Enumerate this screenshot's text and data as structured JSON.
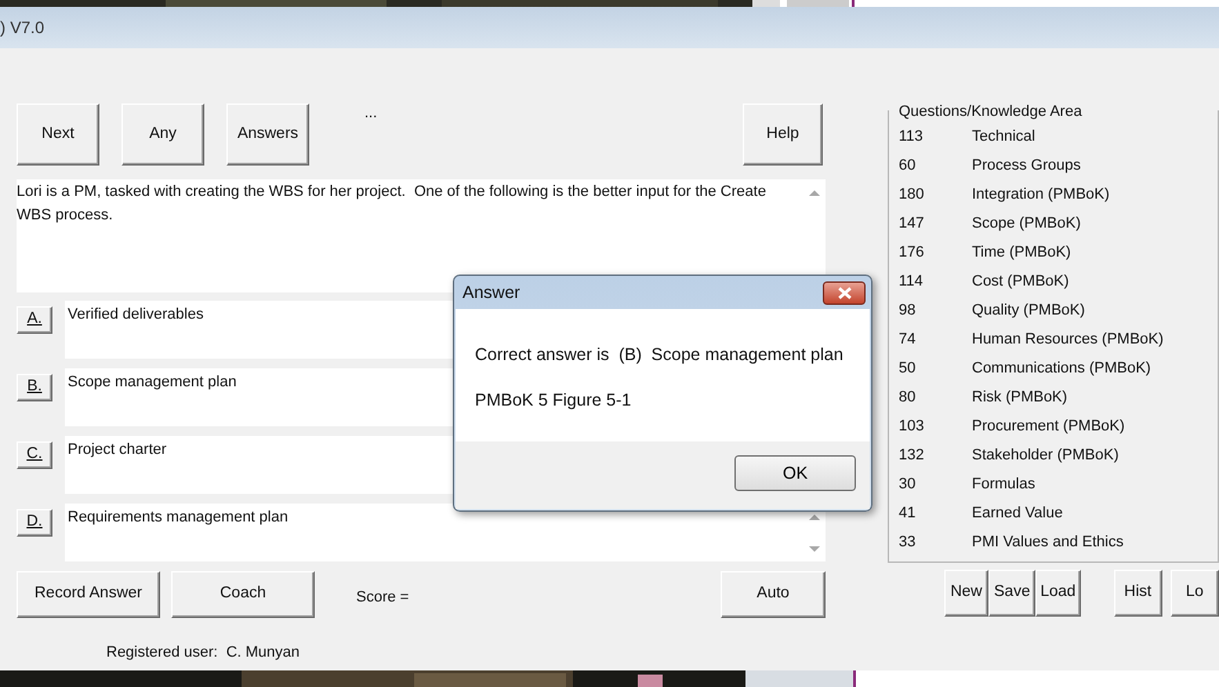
{
  "window": {
    "title": ") V7.0"
  },
  "toolbar": {
    "buttons": [
      "Next",
      "Any",
      "Answers"
    ],
    "ellipsis": "...",
    "help": "Help"
  },
  "question": {
    "text": "Lori is a PM, tasked with creating the WBS for her project.  One of the following is the better input for the Create WBS process.",
    "scrollbar": true
  },
  "options": [
    {
      "letter": "A.",
      "text": "Verified deliverables"
    },
    {
      "letter": "B.",
      "text": "Scope management plan"
    },
    {
      "letter": "C.",
      "text": "Project charter"
    },
    {
      "letter": "D.",
      "text": "Requirements management plan",
      "scrollbar": true
    }
  ],
  "bottom": {
    "buttons": [
      "Record Answer",
      "Coach"
    ],
    "score_label": "Score =",
    "auto": "Auto"
  },
  "file_buttons": [
    "New",
    "Save",
    "Load"
  ],
  "extra_buttons": [
    "Hist",
    "Lo"
  ],
  "registered": "Registered user:  C. Munyan",
  "knowledge_areas": {
    "title": "Questions/Knowledge Area",
    "rows": [
      {
        "count": "113",
        "area": "Technical"
      },
      {
        "count": "60",
        "area": "Process Groups"
      },
      {
        "count": "180",
        "area": "Integration (PMBoK)"
      },
      {
        "count": "147",
        "area": "Scope (PMBoK)"
      },
      {
        "count": "176",
        "area": "Time (PMBoK)"
      },
      {
        "count": "114",
        "area": "Cost (PMBoK)"
      },
      {
        "count": "98",
        "area": "Quality (PMBoK)"
      },
      {
        "count": "74",
        "area": "Human Resources (PMBoK)"
      },
      {
        "count": "50",
        "area": "Communications (PMBoK)"
      },
      {
        "count": "80",
        "area": "Risk (PMBoK)"
      },
      {
        "count": "103",
        "area": "Procurement (PMBoK)"
      },
      {
        "count": "132",
        "area": "Stakeholder (PMBoK)"
      },
      {
        "count": "30",
        "area": "Formulas"
      },
      {
        "count": "41",
        "area": "Earned Value"
      },
      {
        "count": "33",
        "area": "PMI Values and Ethics"
      }
    ]
  },
  "dialog": {
    "title": "Answer",
    "message": "Correct answer is  (B)  Scope management plan",
    "reference": "PMBoK 5 Figure 5-1",
    "ok": "OK"
  }
}
